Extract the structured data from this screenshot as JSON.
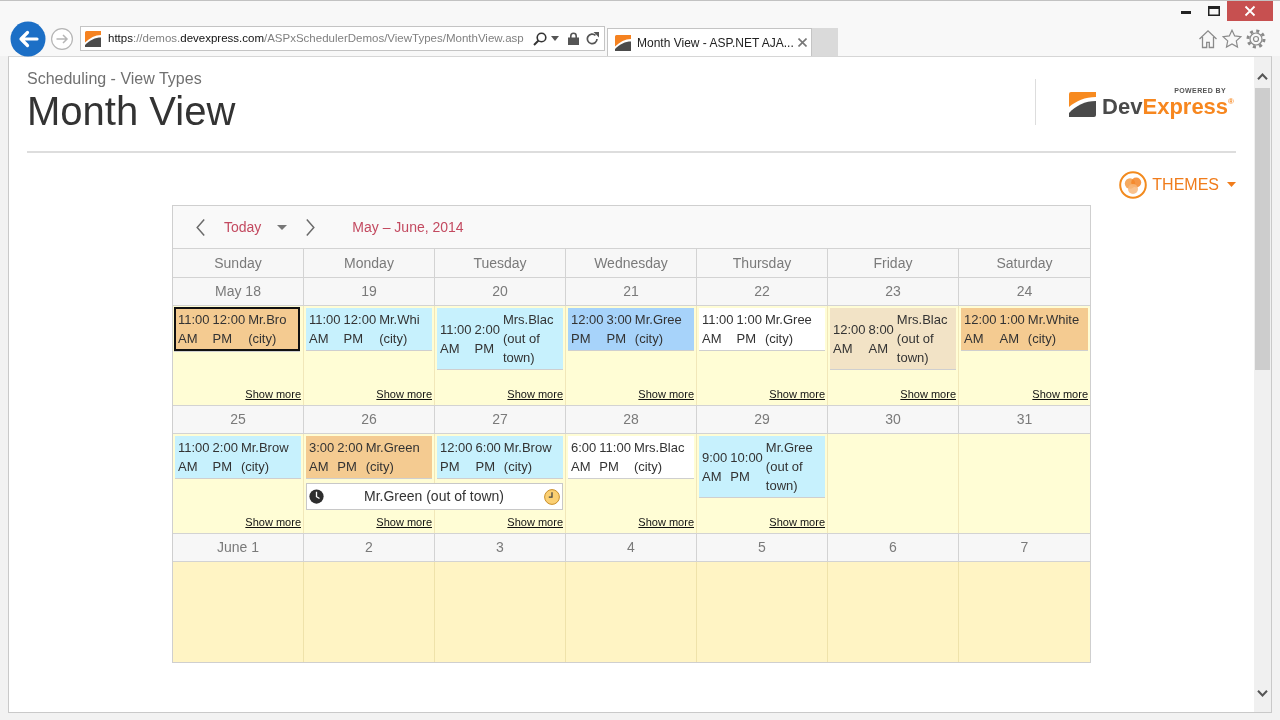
{
  "browser": {
    "url_parts": [
      {
        "text": "https",
        "emphasis": true
      },
      {
        "text": "://demos.",
        "emphasis": false
      },
      {
        "text": "devexpress.com",
        "emphasis": true
      },
      {
        "text": "/ASPxSchedulerDemos/ViewTypes/MonthView.asp",
        "emphasis": false
      }
    ],
    "tab_title": "Month View - ASP.NET AJA..."
  },
  "header": {
    "breadcrumb": "Scheduling - View Types",
    "title": "Month View",
    "logo": {
      "tagline": "POWERED BY",
      "name_dark": "Dev",
      "name_accent": "Express",
      "trademark": "®"
    }
  },
  "themes_button": {
    "label": "THEMES"
  },
  "scheduler": {
    "toolbar": {
      "today": "Today",
      "range": "May – June, 2014"
    },
    "day_names": [
      "Sunday",
      "Monday",
      "Tuesday",
      "Wednesday",
      "Thursday",
      "Friday",
      "Saturday"
    ],
    "weeks": [
      {
        "days": [
          {
            "date": "May 18",
            "shaded": false,
            "appointments": [
              {
                "kind": "timed",
                "start": "11:00 AM",
                "end": "12:00 PM",
                "subject": "Mr.Bro (city)",
                "color": "#f4cb91",
                "selected": true,
                "continues": false
              }
            ],
            "show_more": "Show more"
          },
          {
            "date": "19",
            "shaded": false,
            "appointments": [
              {
                "kind": "timed",
                "start": "11:00 AM",
                "end": "12:00 PM",
                "subject": "Mr.Whi (city)",
                "color": "#c7f1fd",
                "selected": false,
                "continues": false
              }
            ],
            "show_more": "Show more"
          },
          {
            "date": "20",
            "shaded": false,
            "appointments": [
              {
                "kind": "timed",
                "start": "11:00 AM",
                "end": "2:00 PM",
                "subject": "Mrs.Blac (out of town)",
                "color": "#c7f1fd",
                "selected": false,
                "continues": false
              }
            ],
            "show_more": "Show more"
          },
          {
            "date": "21",
            "shaded": false,
            "appointments": [
              {
                "kind": "timed",
                "start": "12:00 PM",
                "end": "3:00 PM",
                "subject": "Mr.Gree (city)",
                "color": "#a7d3fa",
                "selected": false,
                "continues": false
              }
            ],
            "show_more": "Show more"
          },
          {
            "date": "22",
            "shaded": false,
            "appointments": [
              {
                "kind": "timed",
                "start": "11:00 AM",
                "end": "1:00 PM",
                "subject": "Mr.Gree (city)",
                "color": "#ffffff",
                "selected": false,
                "continues": false
              }
            ],
            "show_more": "Show more"
          },
          {
            "date": "23",
            "shaded": false,
            "appointments": [
              {
                "kind": "timed",
                "start": "12:00 AM",
                "end": "8:00 AM",
                "subject": "Mrs.Blac (out of town)",
                "color": "#f2e3c6",
                "selected": false,
                "continues": false
              }
            ],
            "show_more": "Show more"
          },
          {
            "date": "24",
            "shaded": false,
            "appointments": [
              {
                "kind": "timed",
                "start": "12:00 AM",
                "end": "1:00 AM",
                "subject": "Mr.White (city)",
                "color": "#f4cb91",
                "selected": false,
                "continues": false
              }
            ],
            "show_more": "Show more"
          }
        ]
      },
      {
        "days": [
          {
            "date": "25",
            "shaded": false,
            "appointments": [
              {
                "kind": "timed",
                "start": "11:00 AM",
                "end": "2:00 PM",
                "subject": "Mr.Brow (city)",
                "color": "#c7f1fd",
                "selected": false,
                "continues": false
              }
            ],
            "show_more": "Show more"
          },
          {
            "date": "26",
            "shaded": false,
            "appointments": [
              {
                "kind": "timed",
                "start": "3:00 AM",
                "end": "2:00 PM",
                "subject": "Mr.Green (city)",
                "color": "#f4cb91",
                "selected": false,
                "continues": false
              },
              {
                "kind": "spanning",
                "subject": "Mr.Green (out of town)",
                "color": "#ffffff",
                "selected": false,
                "continues": true
              }
            ],
            "show_more": "Show more"
          },
          {
            "date": "27",
            "shaded": false,
            "appointments": [
              {
                "kind": "timed",
                "start": "12:00 PM",
                "end": "6:00 PM",
                "subject": "Mr.Brow (city)",
                "color": "#c7f1fd",
                "selected": false,
                "continues": false
              }
            ],
            "show_more": "Show more"
          },
          {
            "date": "28",
            "shaded": false,
            "appointments": [
              {
                "kind": "timed",
                "start": "6:00 AM",
                "end": "11:00 PM",
                "subject": "Mrs.Blac (city)",
                "color": "#ffffff",
                "selected": false,
                "continues": false
              }
            ],
            "show_more": "Show more"
          },
          {
            "date": "29",
            "shaded": false,
            "appointments": [
              {
                "kind": "timed",
                "start": "9:00 AM",
                "end": "10:00 PM",
                "subject": "Mr.Gree (out of town)",
                "color": "#c7f1fd",
                "selected": false,
                "continues": false
              }
            ],
            "show_more": "Show more"
          },
          {
            "date": "30",
            "shaded": false
          },
          {
            "date": "31",
            "shaded": false
          }
        ]
      },
      {
        "days": [
          {
            "date": "June 1",
            "shaded": true
          },
          {
            "date": "2",
            "shaded": true
          },
          {
            "date": "3",
            "shaded": true
          },
          {
            "date": "4",
            "shaded": true
          },
          {
            "date": "5",
            "shaded": true
          },
          {
            "date": "6",
            "shaded": true
          },
          {
            "date": "7",
            "shaded": true
          }
        ]
      }
    ]
  }
}
